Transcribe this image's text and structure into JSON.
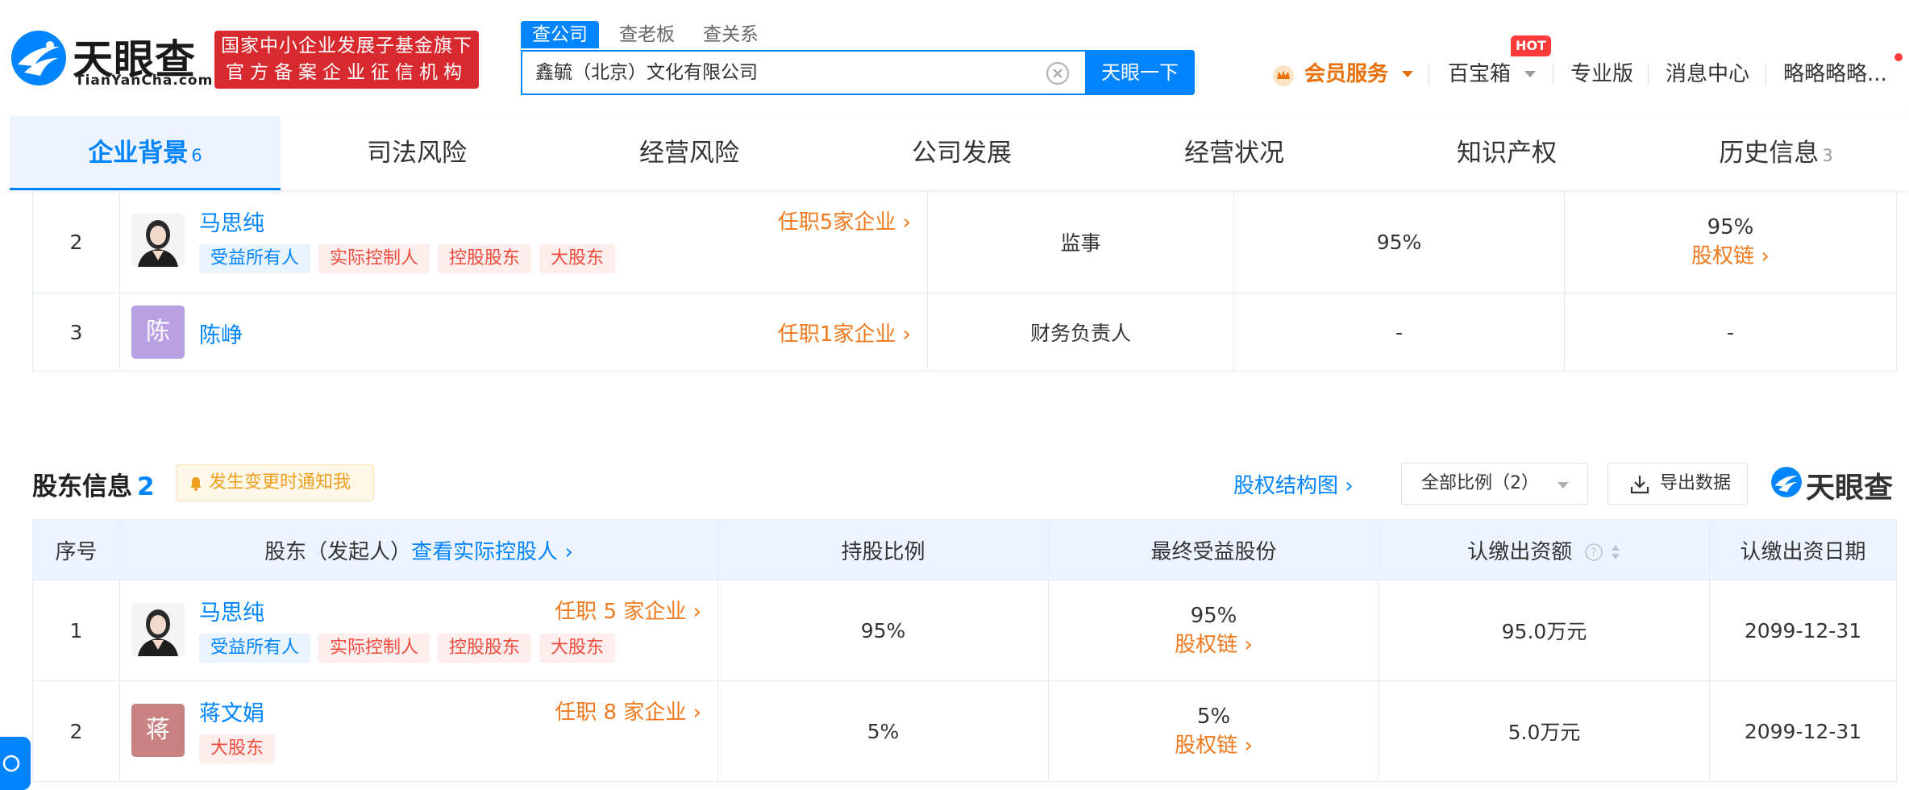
{
  "header": {
    "logo_text": "天眼查",
    "logo_sub": "TianYanCha.com",
    "gov_badge_line1": "国家中小企业发展子基金旗下",
    "gov_badge_line2": "官方备案企业征信机构",
    "search_tabs": [
      "查公司",
      "查老板",
      "查关系"
    ],
    "search_value": "鑫毓（北京）文化有限公司",
    "search_button": "天眼一下",
    "nav": {
      "vip": "会员服务",
      "toolbox": "百宝箱",
      "hot": "HOT",
      "pro": "专业版",
      "messages": "消息中心",
      "user": "略略略略..."
    }
  },
  "section_tabs": [
    {
      "label": "企业背景",
      "count": "6"
    },
    {
      "label": "司法风险",
      "count": ""
    },
    {
      "label": "经营风险",
      "count": ""
    },
    {
      "label": "公司发展",
      "count": ""
    },
    {
      "label": "经营状况",
      "count": ""
    },
    {
      "label": "知识产权",
      "count": ""
    },
    {
      "label": "历史信息",
      "count": "3"
    }
  ],
  "staff_rows": [
    {
      "index": "2",
      "name": "马思纯",
      "roles": "任职5家企业",
      "tags": [
        "受益所有人",
        "实际控制人",
        "控股股东",
        "大股东"
      ],
      "position": "监事",
      "ratio": "95%",
      "final_ratio": "95%",
      "chain_label": "股权链"
    },
    {
      "index": "3",
      "name": "陈峥",
      "avatar_char": "陈",
      "roles": "任职1家企业",
      "tags": [],
      "position": "财务负责人",
      "ratio": "-",
      "final_ratio": "-"
    }
  ],
  "shareholders": {
    "title": "股东信息",
    "count": "2",
    "notify": "发生变更时通知我",
    "structure_link": "股权结构图",
    "ratio_select": "全部比例（2）",
    "export": "导出数据",
    "watermark": "天眼查",
    "columns": [
      "序号",
      "股东（发起人）",
      "查看实际控股人",
      "持股比例",
      "最终受益股份",
      "认缴出资额",
      "认缴出资日期"
    ],
    "rows": [
      {
        "index": "1",
        "name": "马思纯",
        "roles": "任职 5 家企业",
        "tags": [
          "受益所有人",
          "实际控制人",
          "控股股东",
          "大股东"
        ],
        "ratio": "95%",
        "final_ratio": "95%",
        "chain_label": "股权链",
        "amount": "95.0万元",
        "date": "2099-12-31"
      },
      {
        "index": "2",
        "name": "蒋文娟",
        "avatar_char": "蒋",
        "roles": "任职 8 家企业",
        "tags": [
          "大股东"
        ],
        "ratio": "5%",
        "final_ratio": "5%",
        "chain_label": "股权链",
        "amount": "5.0万元",
        "date": "2099-12-31"
      }
    ]
  },
  "colors": {
    "brand_blue": "#0084ff",
    "orange": "#f0791e",
    "gov_red": "#d8292f",
    "avatar_purple": "#b9a0e2",
    "avatar_rose": "#c98282"
  }
}
